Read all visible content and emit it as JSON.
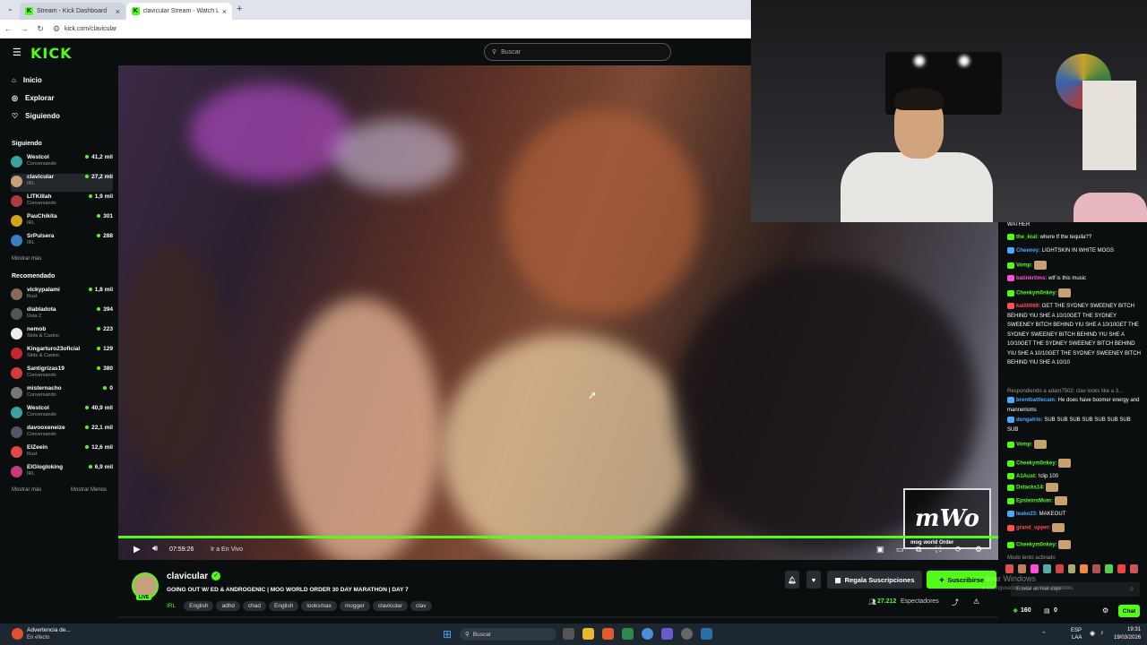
{
  "browser": {
    "tabs": [
      {
        "title": "Stream - Kick Dashboard"
      },
      {
        "title": "clavicular Stream - Watch Live o"
      }
    ],
    "url": "kick.com/clavicular"
  },
  "header": {
    "logo": "KICK",
    "search_placeholder": "Buscar"
  },
  "sidebar": {
    "nav": [
      {
        "label": "Inicio",
        "icon": "home-icon"
      },
      {
        "label": "Explorar",
        "icon": "compass-icon"
      },
      {
        "label": "Siguiendo",
        "icon": "heart-icon"
      }
    ],
    "following_title": "Siguiendo",
    "following": [
      {
        "name": "Westcol",
        "category": "Conversando",
        "viewers": "41,2 mil",
        "color": "#3aa3a0"
      },
      {
        "name": "clavicular",
        "category": "IRL",
        "viewers": "27,2 mil",
        "color": "#c4a27a"
      },
      {
        "name": "LITKillah",
        "category": "Conversando",
        "viewers": "1,9 mil",
        "color": "#b0393f"
      },
      {
        "name": "PauChikita",
        "category": "IRL",
        "viewers": "301",
        "color": "#d4a21a"
      },
      {
        "name": "SrPulsera",
        "category": "IRL",
        "viewers": "288",
        "color": "#3a7fc4"
      }
    ],
    "show_more": "Mostrar más",
    "recommended_title": "Recomendado",
    "recommended": [
      {
        "name": "vickypalami",
        "category": "Rust",
        "viewers": "1,8 mil",
        "color": "#8a6b5a"
      },
      {
        "name": "diabladota",
        "category": "Dota 2",
        "viewers": "394",
        "color": "#555"
      },
      {
        "name": "nemob",
        "category": "Slots & Casino",
        "viewers": "223",
        "color": "#eee"
      },
      {
        "name": "Kingarturo23oficial",
        "category": "Slots & Casino",
        "viewers": "129",
        "color": "#c0282d"
      },
      {
        "name": "Santigrizas19",
        "category": "Conversando",
        "viewers": "380",
        "color": "#d43a3a"
      },
      {
        "name": "misternacho",
        "category": "Conversando",
        "viewers": "0",
        "color": "#777"
      },
      {
        "name": "Westcol",
        "category": "Conversando",
        "viewers": "40,9 mil",
        "color": "#3aa3a0"
      },
      {
        "name": "davooxeneize",
        "category": "Conversando",
        "viewers": "22,1 mil",
        "color": "#556"
      },
      {
        "name": "ElZeein",
        "category": "Rust",
        "viewers": "12,6 mil",
        "color": "#e04848"
      },
      {
        "name": "ElGlogloking",
        "category": "IRL",
        "viewers": "6,9 mil",
        "color": "#c43a7a"
      }
    ],
    "show_more2": "Mostrar más",
    "show_less": "Mostrar Menos"
  },
  "player": {
    "time": "07:59:26",
    "live_link": "Ir a En Vivo",
    "progress": 1.0,
    "overlay_text": "mWo",
    "overlay_sub": "mog world Order"
  },
  "stream": {
    "channel": "clavicular",
    "title": "GOING OUT W/ ED & ANDROGENIC | MOG WORLD ORDER 30 DAY MARATHON | DAY 7",
    "tags": [
      "IRL",
      "English",
      "adhd",
      "chad",
      "English",
      "looksmax",
      "mogger",
      "clavicular",
      "clav"
    ],
    "live_badge": "LIVE",
    "gift_label": "Regala Suscripciones",
    "subscribe_label": "Suscribirse",
    "viewers": "27.212",
    "viewers_label": "Espectadores"
  },
  "chat": {
    "messages": [
      {
        "user": "",
        "text": "WATHER",
        "color": "#fff"
      },
      {
        "user": "the_kral:",
        "text": " where tf the tequila??",
        "color": "#53fc18"
      },
      {
        "user": "Cheeney:",
        "text": " LIGHTSKIN IN WHITE MOGS",
        "color": "#4aa8ff"
      },
      {
        "user": "Vomp:",
        "text": "",
        "color": "#53fc18"
      },
      {
        "user": "batinkrtims:",
        "text": " wtf is this music",
        "color": "#ff4fd8"
      },
      {
        "user": "Cheekym0nkey:",
        "text": "",
        "color": "#53fc18"
      },
      {
        "user": "kaili0069:",
        "text": " GET THE SYDNEY SWEENEY BITCH BEHIND YIU SHE A 10/10GET THE SYDNEY SWEENEY BITCH BEHIND YIU SHE A 10/10GET THE SYDNEY SWEENEY BITCH BEHIND YIU SHE A 10/10GET THE SYDNEY SWEENEY BITCH BEHIND YIU SHE A 10/10GET THE SYDNEY SWEENEY BITCH BEHIND YIU SHE A 10/10",
        "color": "#ff4f4f"
      },
      {
        "user": "",
        "text": "Respondiendo a adam7502: clav looks like a 3...",
        "color": "#999"
      },
      {
        "user": "brentbattlecam:",
        "text": " He does have boomer energy and mannerisms",
        "color": "#4aa8ff"
      },
      {
        "user": "dongatrio:",
        "text": " SUB SUB SUB SUB SUB SUB SUB SUB",
        "color": "#4aa8ff"
      },
      {
        "user": "Vomp:",
        "text": "",
        "color": "#53fc18"
      },
      {
        "user": "Cheekym0nkey:",
        "text": "",
        "color": "#53fc18"
      },
      {
        "user": "A1Aust:",
        "text": " !clip 100",
        "color": "#53fc18"
      },
      {
        "user": "Dstacks14:",
        "text": "",
        "color": "#53fc18"
      },
      {
        "user": "EpsteinsMum:",
        "text": "",
        "color": "#53fc18"
      },
      {
        "user": "leako23:",
        "text": " MAKEOUT",
        "color": "#4aa8ff"
      },
      {
        "user": "grand_upper:",
        "text": "",
        "color": "#ff4f4f"
      },
      {
        "user": "Cheekym0nkey:",
        "text": "",
        "color": "#53fc18"
      },
      {
        "user": "",
        "text": "Modo lento activado",
        "color": "#999"
      }
    ],
    "input_placeholder": "Enviar un mensaje",
    "points": "160",
    "gifts": "0",
    "chat_button": "Chat",
    "watermark": "tivar Windows",
    "watermark_sub": "a Configuración para activar Windows."
  },
  "taskbar": {
    "notif_title": "Advertencia de...",
    "notif_sub": "En efecto",
    "search": "Buscar",
    "lang": "ESP",
    "lang_sub": "LAA",
    "time": "19:31",
    "date": "19/03/2026"
  }
}
